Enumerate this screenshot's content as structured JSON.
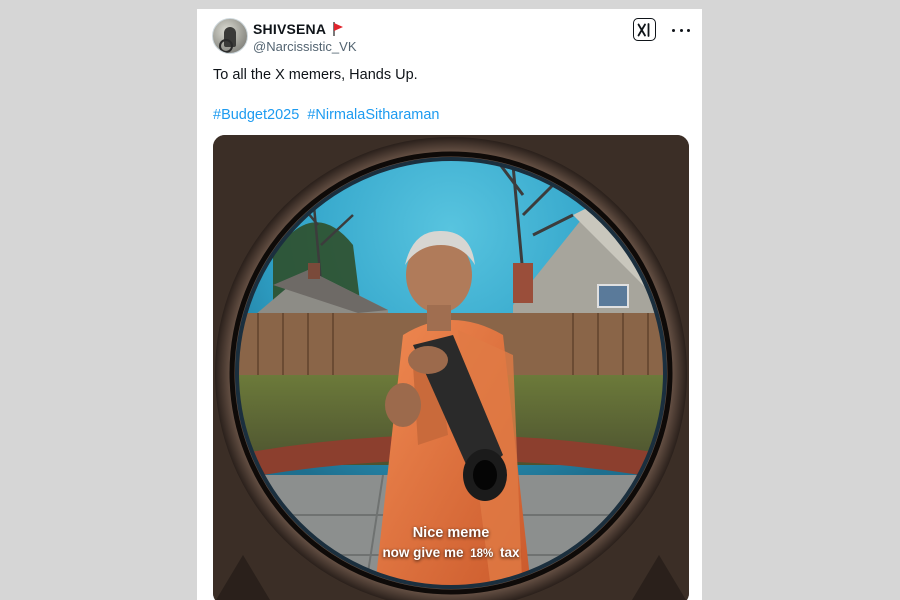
{
  "post": {
    "author": {
      "display_name": "SHIVSENA",
      "handle": "@Narcissistic_VK",
      "badge_icon": "red-flag-icon",
      "avatar_icon": "profile-avatar"
    },
    "brand_icon": "x-logo-icon",
    "more_icon": "more-options-icon",
    "text": "To all the X memers, Hands Up.",
    "hashtags": [
      "#Budget2025",
      "#NirmalaSitharaman"
    ],
    "media": {
      "caption_line1": "Nice meme",
      "caption_line2_prefix": "now give me",
      "caption_line2_value": "18%",
      "caption_line2_suffix": "tax"
    }
  },
  "colors": {
    "page_background": "#d6d6d6",
    "card_background": "#ffffff",
    "link": "#1d9bf0",
    "text_primary": "#0f1419",
    "text_secondary": "#536471",
    "flag": "#e0242c"
  }
}
